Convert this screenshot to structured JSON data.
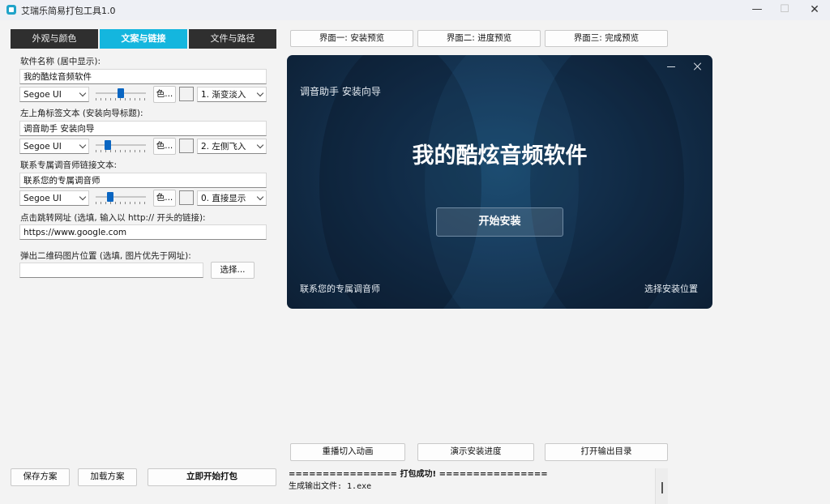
{
  "window": {
    "title": "艾瑞乐简易打包工具1.0",
    "minimize": "—",
    "maximize": "☐",
    "close": "✕"
  },
  "tabs": [
    {
      "label": "外观与颜色"
    },
    {
      "label": "文案与链接"
    },
    {
      "label": "文件与路径"
    }
  ],
  "software_name": {
    "label": "软件名称 (居中显示):",
    "value": "我的酷炫音频软件",
    "font": "Segoe UI",
    "color_button": "色...",
    "animation": "1. 渐变淡入",
    "slider_level": 0.5
  },
  "corner_label": {
    "label": "左上角标签文本 (安装向导标题):",
    "value": "调音助手 安装向导",
    "font": "Segoe UI",
    "color_button": "色...",
    "animation": "2. 左侧飞入",
    "slider_level": 0.2
  },
  "contact_link": {
    "label": "联系专属调音师链接文本:",
    "value": "联系您的专属调音师",
    "font": "Segoe UI",
    "color_button": "色...",
    "animation": "0. 直接显示",
    "slider_level": 0.25
  },
  "url": {
    "label": "点击跳转网址 (选填, 输入以 http:// 开头的链接):",
    "value": "https://www.google.com"
  },
  "qr": {
    "label": "弹出二维码图片位置 (选填, 图片优先于网址):",
    "value": "",
    "choose_button": "选择..."
  },
  "bottom_buttons": {
    "save": "保存方案",
    "load": "加载方案",
    "build": "立即开始打包"
  },
  "preview_buttons": [
    {
      "label": "界面一: 安装预览"
    },
    {
      "label": "界面二: 进度预览"
    },
    {
      "label": "界面三: 完成预览"
    }
  ],
  "preview": {
    "corner_text": "调音助手 安装向导",
    "title": "我的酷炫音频软件",
    "install_button": "开始安装",
    "contact_text": "联系您的专属调音师",
    "location_text": "选择安装位置"
  },
  "action_buttons": {
    "replay": "重播切入动画",
    "demo": "演示安装进度",
    "open_output": "打开输出目录"
  },
  "log": {
    "line1": "================ 打包成功! ================",
    "line2": "生成输出文件: 1.exe"
  },
  "colors": {
    "accent_tab": "#14b6de",
    "dark_tab": "#2f2f2f",
    "preview_bg": "#112a44"
  }
}
